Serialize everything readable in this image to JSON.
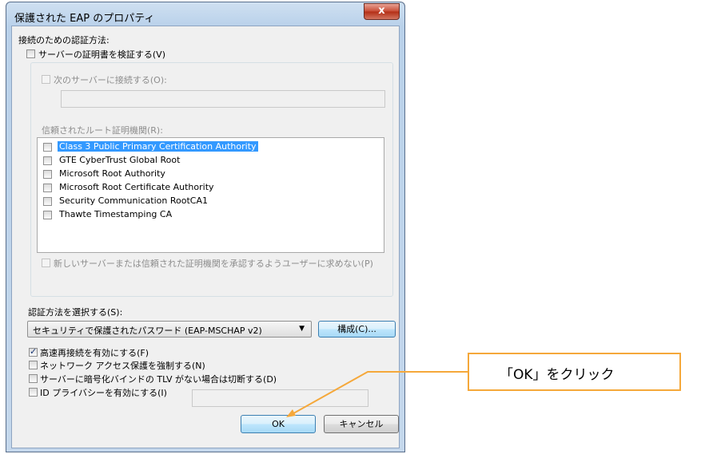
{
  "dialog": {
    "title": "保護された EAP のプロパティ",
    "close_label": "x"
  },
  "connect": {
    "heading": "接続のための認証方法:",
    "verify_cert": "サーバーの証明書を検証する(V)",
    "connect_servers": "次のサーバーに接続する(O):",
    "servers_value": "",
    "trusted_ca_label": "信頼されたルート証明機関(R):",
    "ca_list": [
      "Class 3 Public Primary Certification Authority",
      "GTE CyberTrust Global Root",
      "Microsoft Root Authority",
      "Microsoft Root Certificate Authority",
      "Security Communication RootCA1",
      "Thawte Timestamping CA"
    ],
    "no_prompt": "新しいサーバーまたは信頼された証明機関を承認するようユーザーに求めない(P)"
  },
  "auth": {
    "select_label": "認証方法を選択する(S):",
    "selected_method": "セキュリティで保護されたパスワード (EAP-MSCHAP v2)",
    "configure_button": "構成(C)..."
  },
  "options": {
    "fast_reconnect": "高速再接続を有効にする(F)",
    "nap_enforce": "ネットワーク アクセス保護を強制する(N)",
    "disconnect_tlv": "サーバーに暗号化バインドの TLV がない場合は切断する(D)",
    "identity_privacy": "ID プライバシーを有効にする(I)",
    "identity_value": ""
  },
  "buttons": {
    "ok": "OK",
    "cancel": "キャンセル"
  },
  "annotation": {
    "callout_text": "「OK」をクリック",
    "color": "#f5a83a"
  }
}
